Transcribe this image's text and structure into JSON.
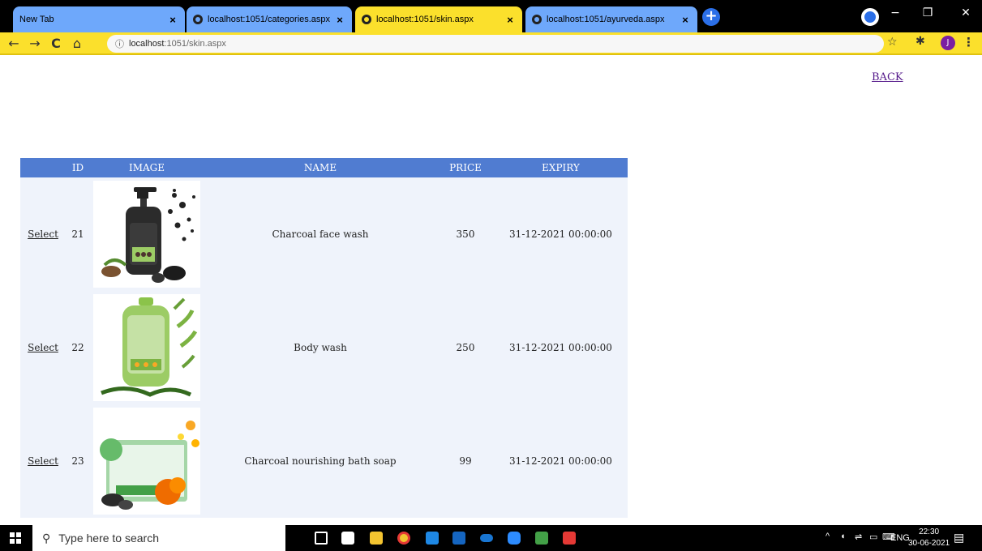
{
  "browser": {
    "tabs": [
      {
        "title": "New Tab",
        "active": false
      },
      {
        "title": "localhost:1051/categories.aspx",
        "active": false
      },
      {
        "title": "localhost:1051/skin.aspx",
        "active": true
      },
      {
        "title": "localhost:1051/ayurveda.aspx",
        "active": false
      }
    ],
    "url_host": "localhost",
    "url_path": ":1051/skin.aspx",
    "profile_initial": "J",
    "colors": {
      "tab": "#6ea8fb",
      "active_tab": "#fbe02c",
      "address_bar": "#fbe02c"
    }
  },
  "page": {
    "back_label": "BACK",
    "columns": [
      "",
      "ID",
      "IMAGE",
      "NAME",
      "PRICE",
      "EXPIRY"
    ],
    "select_label": "Select",
    "rows": [
      {
        "id": "21",
        "name": "Charcoal face wash",
        "price": "350",
        "expiry": "31-12-2021 00:00:00",
        "image": "charcoal-face-wash-image"
      },
      {
        "id": "22",
        "name": "Body wash",
        "price": "250",
        "expiry": "31-12-2021 00:00:00",
        "image": "body-wash-image"
      },
      {
        "id": "23",
        "name": "Charcoal nourishing bath soap",
        "price": "99",
        "expiry": "31-12-2021 00:00:00",
        "image": "bath-soap-image"
      }
    ],
    "colors": {
      "header": "#507cd1",
      "row": "#eff3fb",
      "back_link": "#551a8b"
    }
  },
  "taskbar": {
    "search_placeholder": "Type here to search",
    "language": "ENG",
    "time": "22:30",
    "date": "30-06-2021"
  }
}
